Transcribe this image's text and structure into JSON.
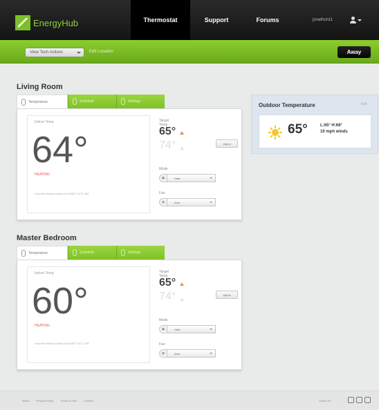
{
  "brand": {
    "name": "EnergyHub"
  },
  "nav": {
    "tabs": [
      "Thermostat",
      "Support",
      "Forums"
    ],
    "active": "Thermostat",
    "user_name": "jonathon11"
  },
  "subbar": {
    "dropdown_label": "View Tech Actions",
    "link_label": "Edit Location",
    "away_label": "Away"
  },
  "rooms": [
    {
      "name": "Living Room",
      "tabs": [
        "Temperature",
        "Schedule",
        "Settings"
      ],
      "indoor_label": "Indoor Temp",
      "indoor_temp": "64°",
      "status": "HEATING",
      "updated": "Last thermostat contact at 5/28/07 10:27 AM",
      "target_label": "Target Temp",
      "target_heat": "65°",
      "target_cool": "74°",
      "adjust_label": "Adjust",
      "mode_label": "Mode",
      "mode_value": "Heat",
      "fan_label": "Fan",
      "fan_value": "Auto"
    },
    {
      "name": "Master Bedroom",
      "tabs": [
        "Temperature",
        "Schedule",
        "Settings"
      ],
      "indoor_label": "Indoor Temp",
      "indoor_temp": "60°",
      "status": "HEATING",
      "updated": "Last thermostat contact at 5/28/07 10:27 AM",
      "target_label": "Target Temp",
      "target_heat": "65°",
      "target_cool": "74°",
      "adjust_label": "Adjust",
      "mode_label": "Mode",
      "mode_value": "Heat",
      "fan_label": "Fan",
      "fan_value": "Auto"
    }
  ],
  "outdoor": {
    "title": "Outdoor Temperature",
    "edit_label": "Edit",
    "temp": "65°",
    "high_low": "L:65° H:68°",
    "wind": "10 mph winds"
  },
  "footer": {
    "links": [
      "About",
      "Privacy Policy",
      "Terms of Use",
      "Contact"
    ],
    "check_us": "Check Us"
  },
  "colors": {
    "accent_green": "#7fc227",
    "heating_red": "#e25a4f",
    "nav_dark": "#141414"
  }
}
